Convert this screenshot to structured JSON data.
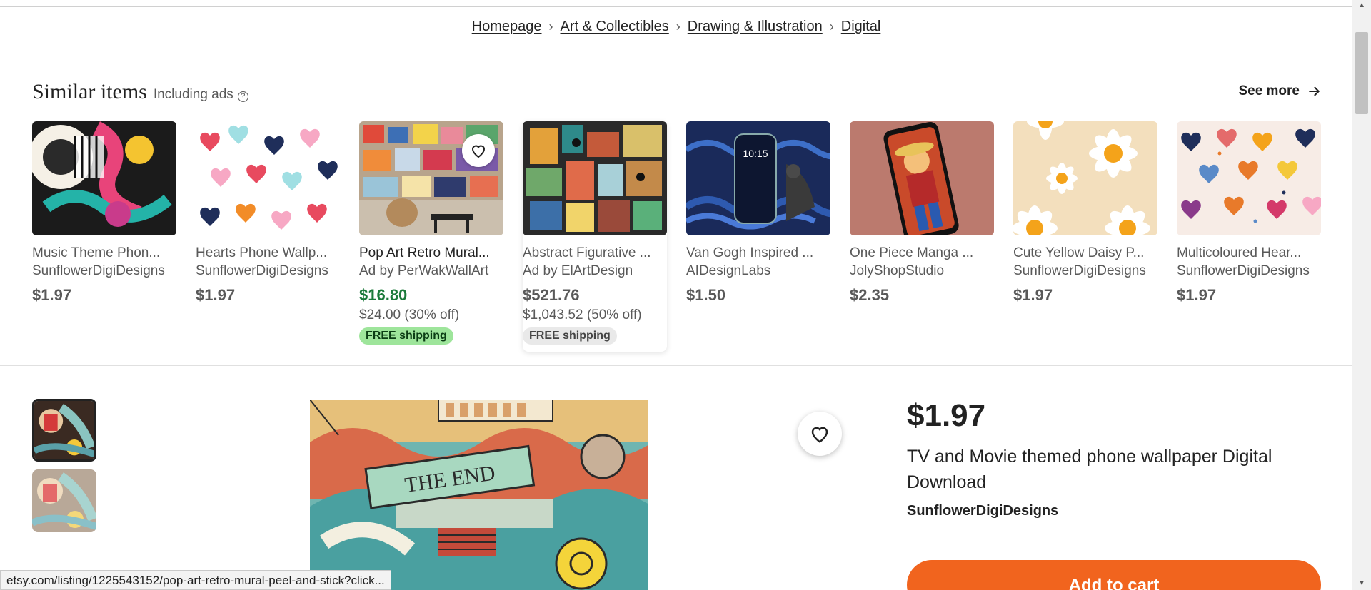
{
  "breadcrumb": [
    {
      "label": "Homepage"
    },
    {
      "label": "Art & Collectibles"
    },
    {
      "label": "Drawing & Illustration"
    },
    {
      "label": "Digital"
    }
  ],
  "similar": {
    "title": "Similar items",
    "subtitle": "Including ads",
    "help_icon": "question-circle-icon",
    "see_more": "See more"
  },
  "cards": [
    {
      "title": "Music Theme Phon...",
      "shop": "SunflowerDigiDesigns",
      "price": "$1.97"
    },
    {
      "title": "Hearts Phone Wallp...",
      "shop": "SunflowerDigiDesigns",
      "price": "$1.97"
    },
    {
      "title": "Pop Art Retro Mural...",
      "shop": "Ad by PerWakWallArt",
      "price": "$16.80",
      "original": "$24.00",
      "discount": "(30% off)",
      "shipping": "FREE shipping"
    },
    {
      "title": "Abstract Figurative ...",
      "shop": "Ad by ElArtDesign",
      "price": "$521.76",
      "original": "$1,043.52",
      "discount": "(50% off)",
      "shipping": "FREE shipping"
    },
    {
      "title": "Van Gogh Inspired ...",
      "shop": "AIDesignLabs",
      "price": "$1.50",
      "phone_time": "10:15"
    },
    {
      "title": "One Piece Manga ...",
      "shop": "JolyShopStudio",
      "price": "$2.35"
    },
    {
      "title": "Cute Yellow Daisy P...",
      "shop": "SunflowerDigiDesigns",
      "price": "$1.97"
    },
    {
      "title": "Multicoloured Hear...",
      "shop": "SunflowerDigiDesigns",
      "price": "$1.97"
    }
  ],
  "product": {
    "price": "$1.97",
    "title": "TV and Movie themed phone wallpaper Digital Download",
    "shop": "SunflowerDigiDesigns",
    "add_to_cart": "Add to cart",
    "image_text": "THE END"
  },
  "status_bar": {
    "url": "etsy.com/listing/1225543152/pop-art-retro-mural-peel-and-stick?click..."
  },
  "colors": {
    "accent": "#f1641e",
    "sale": "#1b7a3a",
    "free_shipping_bg": "#9ee59b"
  }
}
